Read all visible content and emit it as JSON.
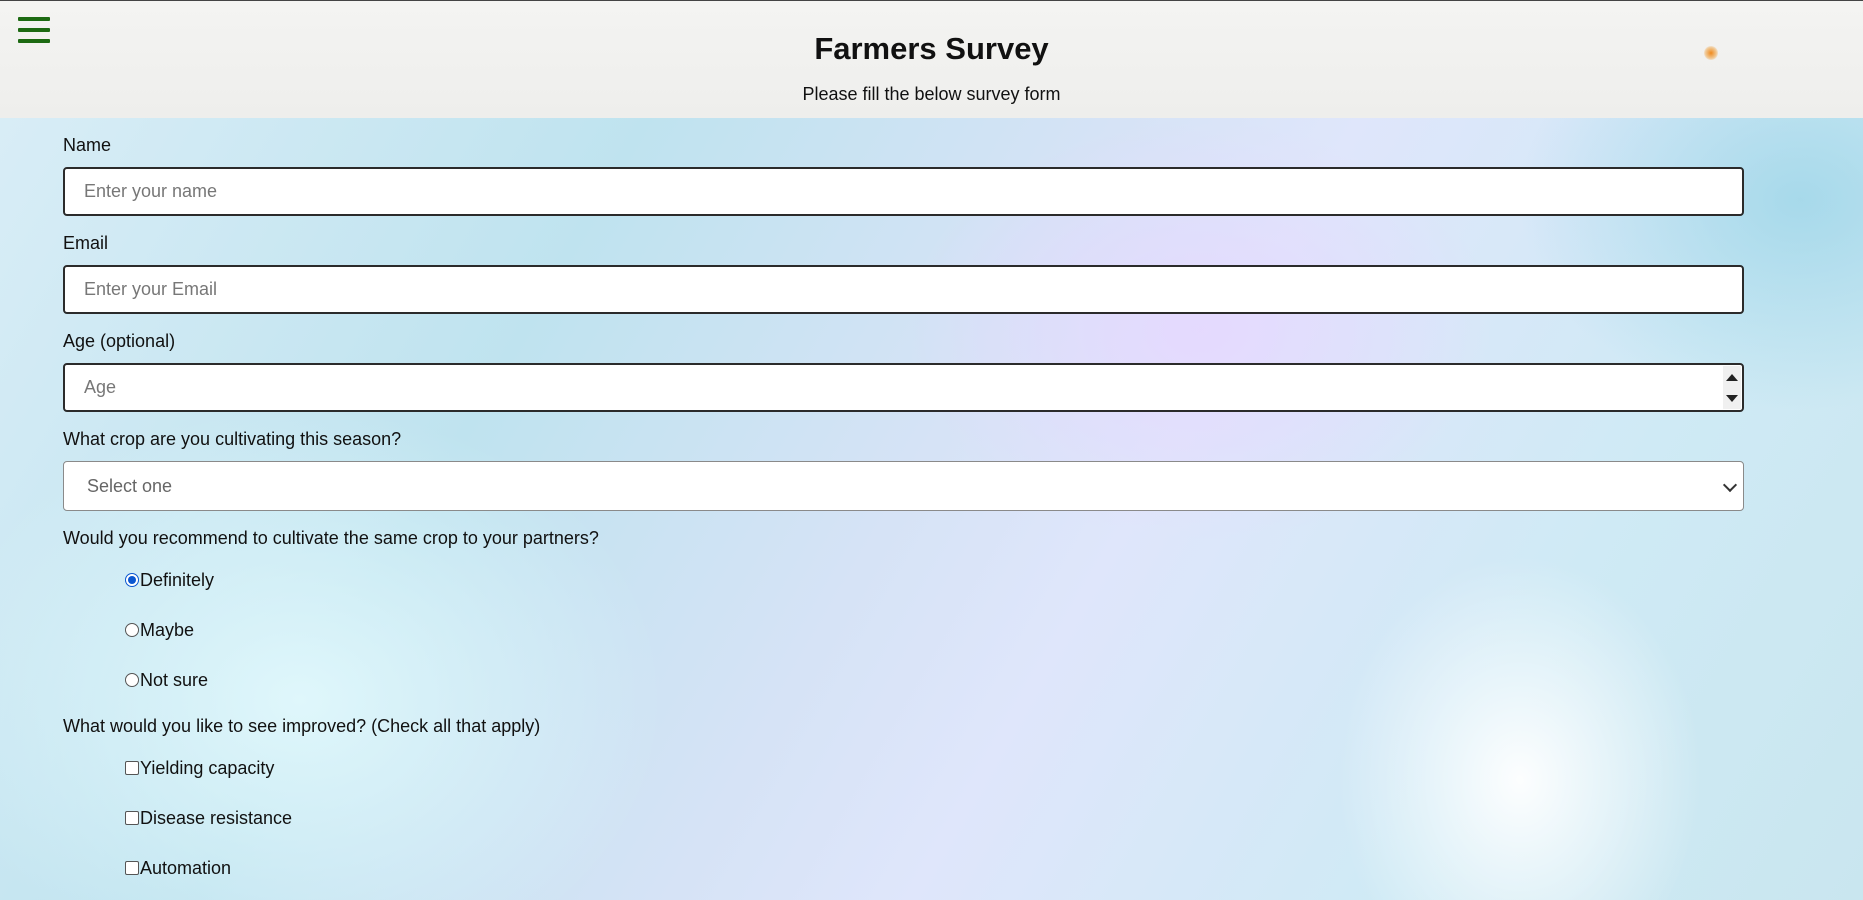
{
  "header": {
    "title": "Farmers Survey",
    "subtitle": "Please fill the below survey form",
    "menu_icon": "hamburger-menu-icon"
  },
  "form": {
    "name": {
      "label": "Name",
      "placeholder": "Enter your name",
      "value": ""
    },
    "email": {
      "label": "Email",
      "placeholder": "Enter your Email",
      "value": ""
    },
    "age": {
      "label": "Age (optional)",
      "placeholder": "Age",
      "value": ""
    },
    "crop": {
      "label": "What crop are you cultivating this season?",
      "selected": "Select one"
    },
    "recommend": {
      "label": "Would you recommend to cultivate the same crop to your partners?",
      "options": [
        {
          "label": "Definitely",
          "checked": true
        },
        {
          "label": "Maybe",
          "checked": false
        },
        {
          "label": "Not sure",
          "checked": false
        }
      ]
    },
    "improve": {
      "label": "What would you like to see improved? (Check all that apply)",
      "options": [
        {
          "label": "Yielding capacity",
          "checked": false
        },
        {
          "label": "Disease resistance",
          "checked": false
        },
        {
          "label": "Automation",
          "checked": false
        }
      ]
    }
  },
  "colors": {
    "menu_icon": "#1d6a12",
    "radio_accent": "#0b57d0"
  }
}
